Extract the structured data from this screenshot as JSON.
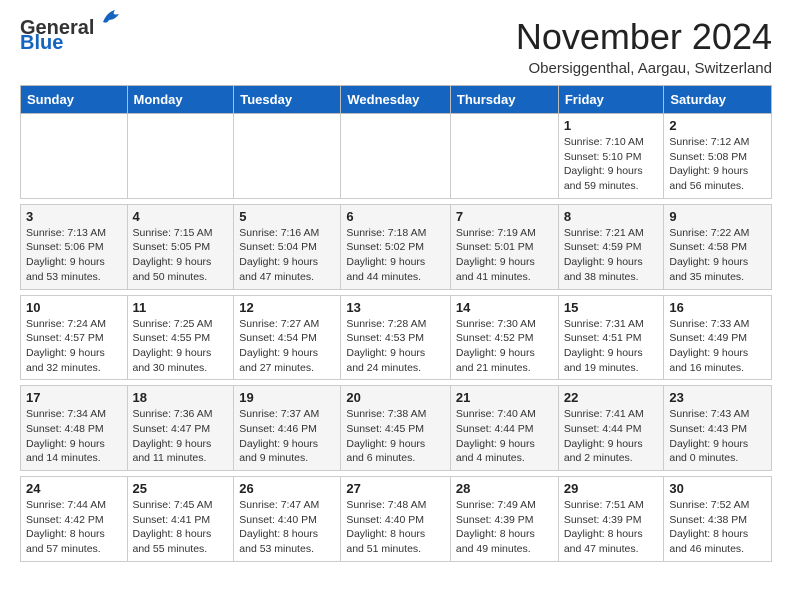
{
  "logo": {
    "general": "General",
    "blue": "Blue"
  },
  "title": "November 2024",
  "location": "Obersiggenthal, Aargau, Switzerland",
  "headers": [
    "Sunday",
    "Monday",
    "Tuesday",
    "Wednesday",
    "Thursday",
    "Friday",
    "Saturday"
  ],
  "weeks": [
    {
      "days": [
        {
          "num": "",
          "info": ""
        },
        {
          "num": "",
          "info": ""
        },
        {
          "num": "",
          "info": ""
        },
        {
          "num": "",
          "info": ""
        },
        {
          "num": "",
          "info": ""
        },
        {
          "num": "1",
          "info": "Sunrise: 7:10 AM\nSunset: 5:10 PM\nDaylight: 9 hours and 59 minutes."
        },
        {
          "num": "2",
          "info": "Sunrise: 7:12 AM\nSunset: 5:08 PM\nDaylight: 9 hours and 56 minutes."
        }
      ]
    },
    {
      "days": [
        {
          "num": "3",
          "info": "Sunrise: 7:13 AM\nSunset: 5:06 PM\nDaylight: 9 hours and 53 minutes."
        },
        {
          "num": "4",
          "info": "Sunrise: 7:15 AM\nSunset: 5:05 PM\nDaylight: 9 hours and 50 minutes."
        },
        {
          "num": "5",
          "info": "Sunrise: 7:16 AM\nSunset: 5:04 PM\nDaylight: 9 hours and 47 minutes."
        },
        {
          "num": "6",
          "info": "Sunrise: 7:18 AM\nSunset: 5:02 PM\nDaylight: 9 hours and 44 minutes."
        },
        {
          "num": "7",
          "info": "Sunrise: 7:19 AM\nSunset: 5:01 PM\nDaylight: 9 hours and 41 minutes."
        },
        {
          "num": "8",
          "info": "Sunrise: 7:21 AM\nSunset: 4:59 PM\nDaylight: 9 hours and 38 minutes."
        },
        {
          "num": "9",
          "info": "Sunrise: 7:22 AM\nSunset: 4:58 PM\nDaylight: 9 hours and 35 minutes."
        }
      ]
    },
    {
      "days": [
        {
          "num": "10",
          "info": "Sunrise: 7:24 AM\nSunset: 4:57 PM\nDaylight: 9 hours and 32 minutes."
        },
        {
          "num": "11",
          "info": "Sunrise: 7:25 AM\nSunset: 4:55 PM\nDaylight: 9 hours and 30 minutes."
        },
        {
          "num": "12",
          "info": "Sunrise: 7:27 AM\nSunset: 4:54 PM\nDaylight: 9 hours and 27 minutes."
        },
        {
          "num": "13",
          "info": "Sunrise: 7:28 AM\nSunset: 4:53 PM\nDaylight: 9 hours and 24 minutes."
        },
        {
          "num": "14",
          "info": "Sunrise: 7:30 AM\nSunset: 4:52 PM\nDaylight: 9 hours and 21 minutes."
        },
        {
          "num": "15",
          "info": "Sunrise: 7:31 AM\nSunset: 4:51 PM\nDaylight: 9 hours and 19 minutes."
        },
        {
          "num": "16",
          "info": "Sunrise: 7:33 AM\nSunset: 4:49 PM\nDaylight: 9 hours and 16 minutes."
        }
      ]
    },
    {
      "days": [
        {
          "num": "17",
          "info": "Sunrise: 7:34 AM\nSunset: 4:48 PM\nDaylight: 9 hours and 14 minutes."
        },
        {
          "num": "18",
          "info": "Sunrise: 7:36 AM\nSunset: 4:47 PM\nDaylight: 9 hours and 11 minutes."
        },
        {
          "num": "19",
          "info": "Sunrise: 7:37 AM\nSunset: 4:46 PM\nDaylight: 9 hours and 9 minutes."
        },
        {
          "num": "20",
          "info": "Sunrise: 7:38 AM\nSunset: 4:45 PM\nDaylight: 9 hours and 6 minutes."
        },
        {
          "num": "21",
          "info": "Sunrise: 7:40 AM\nSunset: 4:44 PM\nDaylight: 9 hours and 4 minutes."
        },
        {
          "num": "22",
          "info": "Sunrise: 7:41 AM\nSunset: 4:44 PM\nDaylight: 9 hours and 2 minutes."
        },
        {
          "num": "23",
          "info": "Sunrise: 7:43 AM\nSunset: 4:43 PM\nDaylight: 9 hours and 0 minutes."
        }
      ]
    },
    {
      "days": [
        {
          "num": "24",
          "info": "Sunrise: 7:44 AM\nSunset: 4:42 PM\nDaylight: 8 hours and 57 minutes."
        },
        {
          "num": "25",
          "info": "Sunrise: 7:45 AM\nSunset: 4:41 PM\nDaylight: 8 hours and 55 minutes."
        },
        {
          "num": "26",
          "info": "Sunrise: 7:47 AM\nSunset: 4:40 PM\nDaylight: 8 hours and 53 minutes."
        },
        {
          "num": "27",
          "info": "Sunrise: 7:48 AM\nSunset: 4:40 PM\nDaylight: 8 hours and 51 minutes."
        },
        {
          "num": "28",
          "info": "Sunrise: 7:49 AM\nSunset: 4:39 PM\nDaylight: 8 hours and 49 minutes."
        },
        {
          "num": "29",
          "info": "Sunrise: 7:51 AM\nSunset: 4:39 PM\nDaylight: 8 hours and 47 minutes."
        },
        {
          "num": "30",
          "info": "Sunrise: 7:52 AM\nSunset: 4:38 PM\nDaylight: 8 hours and 46 minutes."
        }
      ]
    }
  ]
}
